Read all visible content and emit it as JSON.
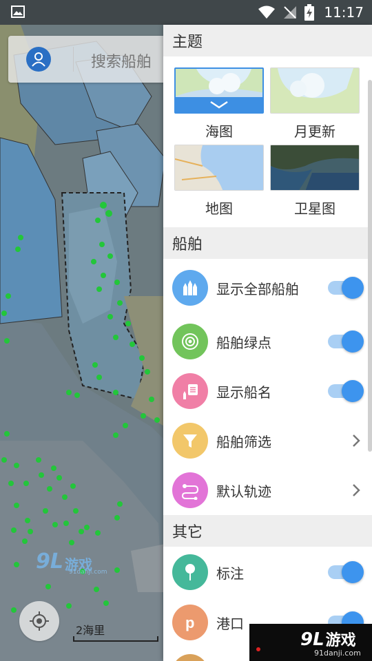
{
  "status_bar": {
    "time": "11:17"
  },
  "search": {
    "placeholder": "搜索船舶"
  },
  "map": {
    "scale_label": "2海里"
  },
  "watermark": {
    "brand": "9L",
    "brand_cn": "游戏",
    "site": "91danji.com"
  },
  "drawer": {
    "theme_section": {
      "title": "主题",
      "themes": [
        {
          "label": "海图",
          "selected": true
        },
        {
          "label": "月更新",
          "selected": false
        },
        {
          "label": "地图",
          "selected": false
        },
        {
          "label": "卫星图",
          "selected": false
        }
      ]
    },
    "ship_section": {
      "title": "船舶",
      "items": [
        {
          "label": "显示全部船舶",
          "control": "toggle",
          "on": true,
          "icon": "ships-icon",
          "color": "#5ea9ee"
        },
        {
          "label": "船舶绿点",
          "control": "toggle",
          "on": true,
          "icon": "green-dot-icon",
          "color": "#72c45b"
        },
        {
          "label": "显示船名",
          "control": "toggle",
          "on": true,
          "icon": "ship-name-icon",
          "color": "#f07fa6"
        },
        {
          "label": "船舶筛选",
          "control": "chevron",
          "icon": "filter-icon",
          "color": "#f2c76a"
        },
        {
          "label": "默认轨迹",
          "control": "chevron",
          "icon": "track-icon",
          "color": "#e274d7"
        }
      ]
    },
    "other_section": {
      "title": "其它",
      "items": [
        {
          "label": "标注",
          "control": "toggle",
          "on": true,
          "icon": "pin-icon",
          "color": "#45b89a"
        },
        {
          "label": "港口",
          "control": "toggle",
          "on": true,
          "icon": "port-icon",
          "color": "#ec9a6e"
        }
      ]
    }
  },
  "colors": {
    "accent": "#3d94ee",
    "section_bg": "#eeeeee"
  }
}
